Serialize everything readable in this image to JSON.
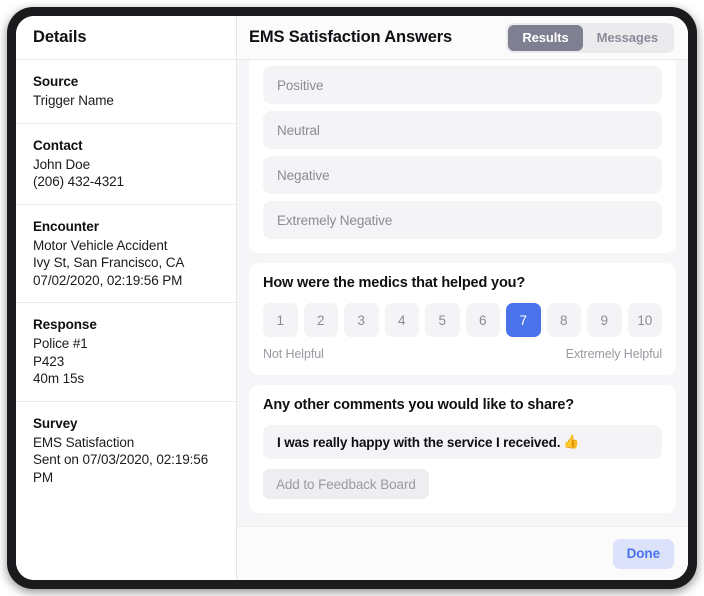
{
  "sidebar": {
    "title": "Details",
    "sections": [
      {
        "label": "Source",
        "lines": [
          "Trigger Name"
        ]
      },
      {
        "label": "Contact",
        "lines": [
          "John Doe",
          "(206) 432-4321"
        ]
      },
      {
        "label": "Encounter",
        "lines": [
          "Motor Vehicle Accident",
          "Ivy St, San Francisco, CA",
          "07/02/2020, 02:19:56 PM"
        ]
      },
      {
        "label": "Response",
        "lines": [
          "Police #1",
          "P423",
          "40m 15s"
        ]
      },
      {
        "label": "Survey",
        "lines": [
          "EMS Satisfaction",
          "Sent on 07/03/2020, 02:19:56 PM"
        ]
      }
    ]
  },
  "header": {
    "title": "EMS Satisfaction Answers",
    "tabs": [
      {
        "label": "Results",
        "active": true
      },
      {
        "label": "Messages",
        "active": false
      }
    ]
  },
  "answers": {
    "options": [
      "Positive",
      "Neutral",
      "Negative",
      "Extremely Negative"
    ]
  },
  "rating": {
    "question": "How were the medics that helped you?",
    "values": [
      "1",
      "2",
      "3",
      "4",
      "5",
      "6",
      "7",
      "8",
      "9",
      "10"
    ],
    "selected": "7",
    "low_label": "Not Helpful",
    "high_label": "Extremely Helpful"
  },
  "comments": {
    "question": "Any other comments you would like to share?",
    "text": "I was really happy with the service I received.",
    "emoji": "👍",
    "button_label": "Add to Feedback Board"
  },
  "footer": {
    "done_label": "Done"
  },
  "colors": {
    "accent_blue": "#4a72ea",
    "tab_active": "#7f7f92",
    "done_bg": "#dde2fb"
  }
}
